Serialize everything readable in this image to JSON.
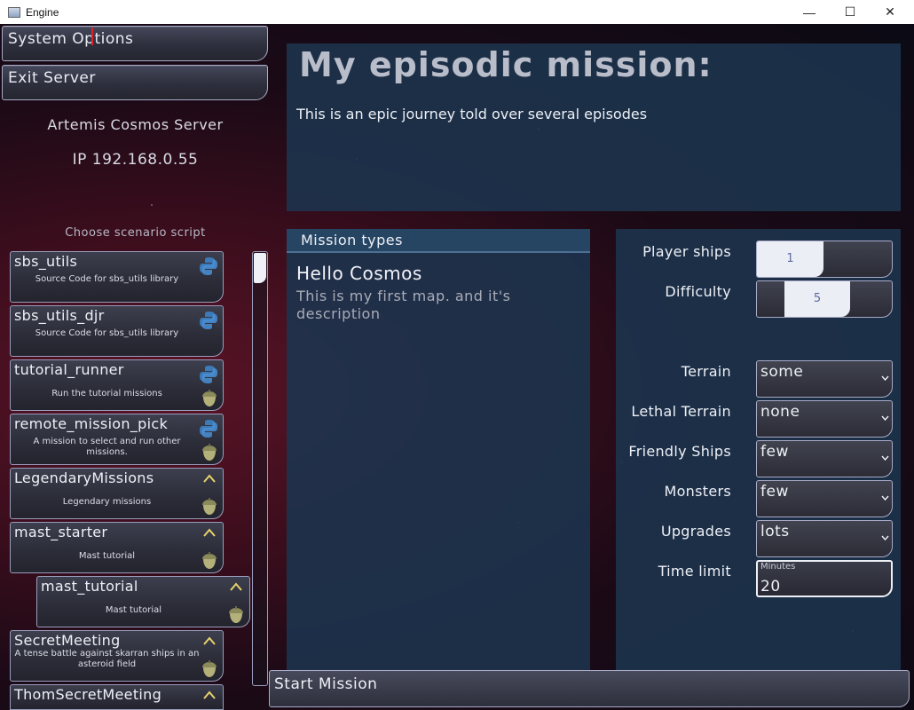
{
  "window": {
    "title": "Engine",
    "minimize_glyph": "—",
    "maximize_glyph": "☐",
    "close_glyph": "✕"
  },
  "sidebar": {
    "system_options_label": "System Options",
    "exit_server_label": "Exit Server",
    "server_name": "Artemis Cosmos Server",
    "server_ip": "IP 192.168.0.55",
    "choose_script_label": "Choose scenario script",
    "scripts": [
      {
        "name": "sbs_utils",
        "description": "Source Code for sbs_utils library",
        "icons": [
          "python-icon"
        ]
      },
      {
        "name": "sbs_utils_djr",
        "description": "Source Code for sbs_utils library",
        "icons": [
          "python-icon"
        ]
      },
      {
        "name": "tutorial_runner",
        "description": "Run the tutorial missions",
        "icons": [
          "python-icon",
          "acorn-icon"
        ]
      },
      {
        "name": "remote_mission_pick",
        "description": "A mission to select and run other missions.",
        "icons": [
          "python-icon",
          "acorn-icon"
        ]
      },
      {
        "name": "LegendaryMissions",
        "description": "Legendary missions",
        "icons": [
          "caret-up-icon",
          "acorn-icon"
        ]
      },
      {
        "name": "mast_starter",
        "description": "Mast tutorial",
        "icons": [
          "caret-up-icon",
          "acorn-icon"
        ]
      },
      {
        "name": "mast_tutorial",
        "description": "Mast tutorial",
        "icons": [
          "caret-up-icon",
          "acorn-icon"
        ],
        "selected": true
      },
      {
        "name": "SecretMeeting",
        "description": "A tense battle against skarran ships in an asteroid field",
        "icons": [
          "caret-up-icon",
          "acorn-icon"
        ]
      },
      {
        "name": "ThomSecretMeeting",
        "description": "",
        "icons": [
          "caret-up-icon"
        ]
      }
    ]
  },
  "mission": {
    "title": "My episodic mission:",
    "description": "This is an epic journey  told over several episodes"
  },
  "mission_types": {
    "header": "Mission types",
    "name": "Hello Cosmos",
    "description": "This is my first map. and it's description"
  },
  "options": {
    "player_ships": {
      "label": "Player ships",
      "value": "1",
      "fraction": 0.5
    },
    "difficulty": {
      "label": "Difficulty",
      "value": "5",
      "fraction": 0.7
    },
    "terrain": {
      "label": "Terrain",
      "value": "some"
    },
    "lethal_terrain": {
      "label": "Lethal Terrain",
      "value": "none"
    },
    "friendly_ships": {
      "label": "Friendly Ships",
      "value": "few"
    },
    "monsters": {
      "label": "Monsters",
      "value": "few"
    },
    "upgrades": {
      "label": "Upgrades",
      "value": "lots"
    },
    "time_limit": {
      "label": "Time limit",
      "caption": "Minutes",
      "value": "20"
    }
  },
  "start_mission_label": "Start Mission",
  "colors": {
    "panel": "#1c344e",
    "accent_border": "#a9abc8",
    "background": "#3a0d1c"
  }
}
